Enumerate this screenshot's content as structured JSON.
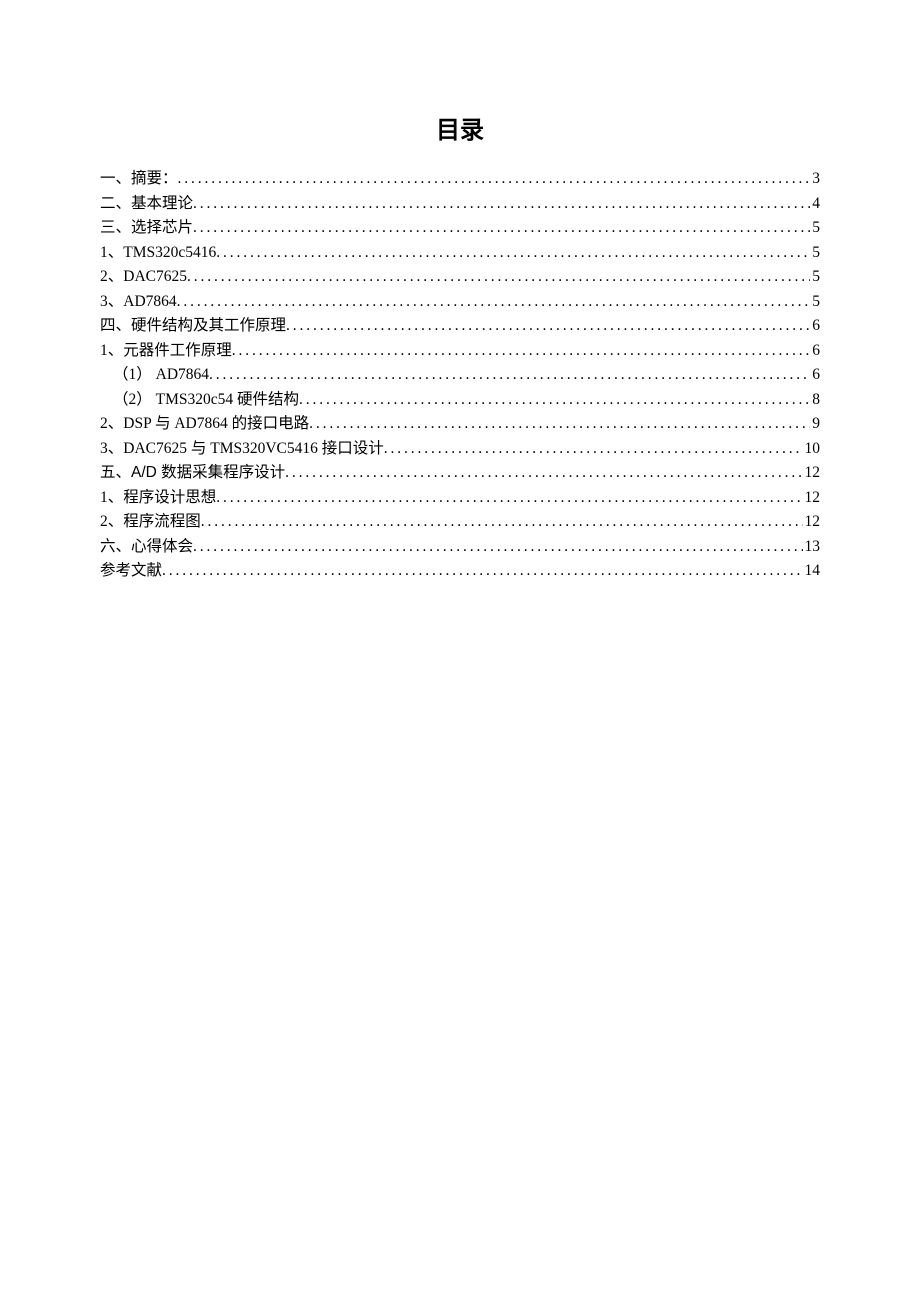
{
  "title": "目录",
  "toc": [
    {
      "label": "一、摘要：",
      "page": "3",
      "bold": true,
      "indent": 0
    },
    {
      "label": "二、基本理论",
      "page": "4",
      "bold": true,
      "indent": 0
    },
    {
      "label": "三、选择芯片",
      "page": "5",
      "bold": true,
      "indent": 0
    },
    {
      "label": "1、TMS320c5416",
      "page": "5",
      "bold": false,
      "indent": 0
    },
    {
      "label": "2、DAC7625",
      "page": "5",
      "bold": false,
      "indent": 0
    },
    {
      "label": "3、AD7864",
      "page": "5",
      "bold": false,
      "indent": 0
    },
    {
      "label": "四、硬件结构及其工作原理",
      "page": "6",
      "bold": true,
      "indent": 0
    },
    {
      "label": "1、元器件工作原理",
      "page": "6",
      "bold": false,
      "indent": 0
    },
    {
      "label": "（1） AD7864",
      "page": "6",
      "bold": false,
      "indent": 1
    },
    {
      "label": "（2） TMS320c54 硬件结构",
      "page": "8",
      "bold": false,
      "indent": 1
    },
    {
      "label": "2、DSP 与 AD7864 的接口电路",
      "page": "9",
      "bold": false,
      "indent": 0
    },
    {
      "label": "3、DAC7625 与 TMS320VC5416 接口设计",
      "page": "10",
      "bold": false,
      "indent": 0
    },
    {
      "label": "五、A/D 数据采集程序设计",
      "page": "12",
      "bold": true,
      "indent": 0
    },
    {
      "label": "1、程序设计思想",
      "page": "12",
      "bold": false,
      "indent": 0
    },
    {
      "label": "2、程序流程图",
      "page": "12",
      "bold": false,
      "indent": 0
    },
    {
      "label": "六、心得体会",
      "page": "13",
      "bold": true,
      "indent": 0
    },
    {
      "label": "参考文献",
      "page": "14",
      "bold": true,
      "indent": 0
    }
  ]
}
